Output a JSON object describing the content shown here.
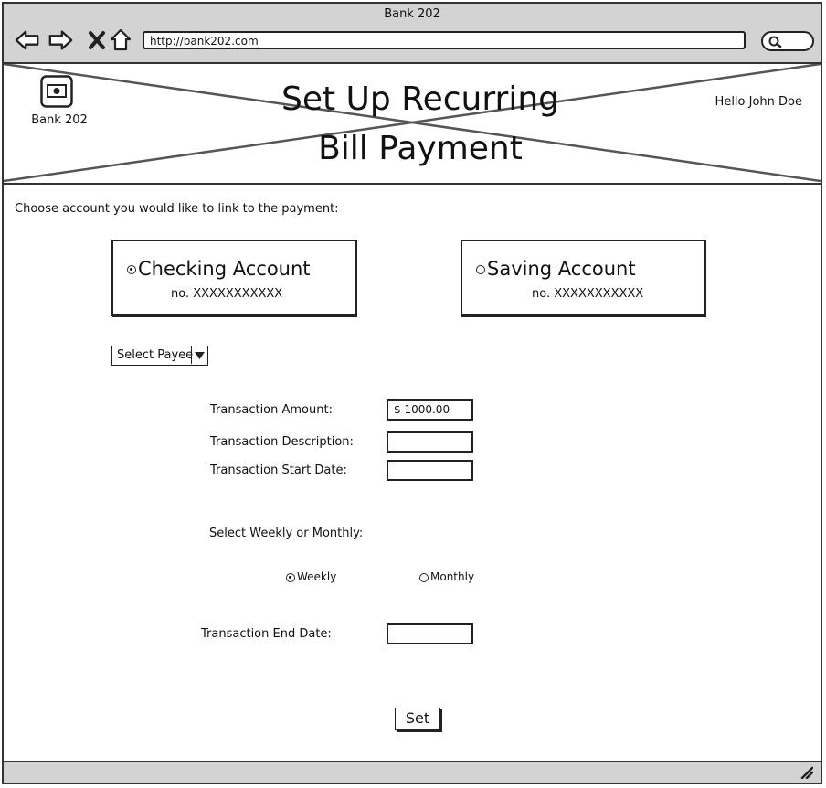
{
  "window": {
    "title": "Bank 202",
    "url": "http://bank202.com"
  },
  "header": {
    "logo_label": "Bank 202",
    "title_line1": "Set Up Recurring",
    "title_line2": "Bill Payment",
    "greeting": "Hello John Doe"
  },
  "main": {
    "prompt": "Choose account you would like to link to the payment:",
    "accounts": [
      {
        "name": "Checking Account",
        "number": "no. XXXXXXXXXXX",
        "selected": true
      },
      {
        "name": "Saving Account",
        "number": "no. XXXXXXXXXXX",
        "selected": false
      }
    ],
    "payee_select": "Select Payee",
    "fields": {
      "amount_label": "Transaction Amount:",
      "amount_value": "$ 1000.00",
      "description_label": "Transaction Description:",
      "description_value": "",
      "start_date_label": "Transaction Start Date:",
      "start_date_value": "",
      "frequency_label": "Select Weekly or Monthly:",
      "end_date_label": "Transaction End Date:",
      "end_date_value": ""
    },
    "frequency_options": [
      {
        "label": "Weekly",
        "selected": true
      },
      {
        "label": "Monthly",
        "selected": false
      }
    ],
    "set_button": "Set"
  },
  "icons": [
    "back-icon",
    "forward-icon",
    "close-icon",
    "home-icon",
    "search-icon",
    "bank-logo-icon",
    "dropdown-arrow-icon",
    "resize-grip-icon"
  ]
}
